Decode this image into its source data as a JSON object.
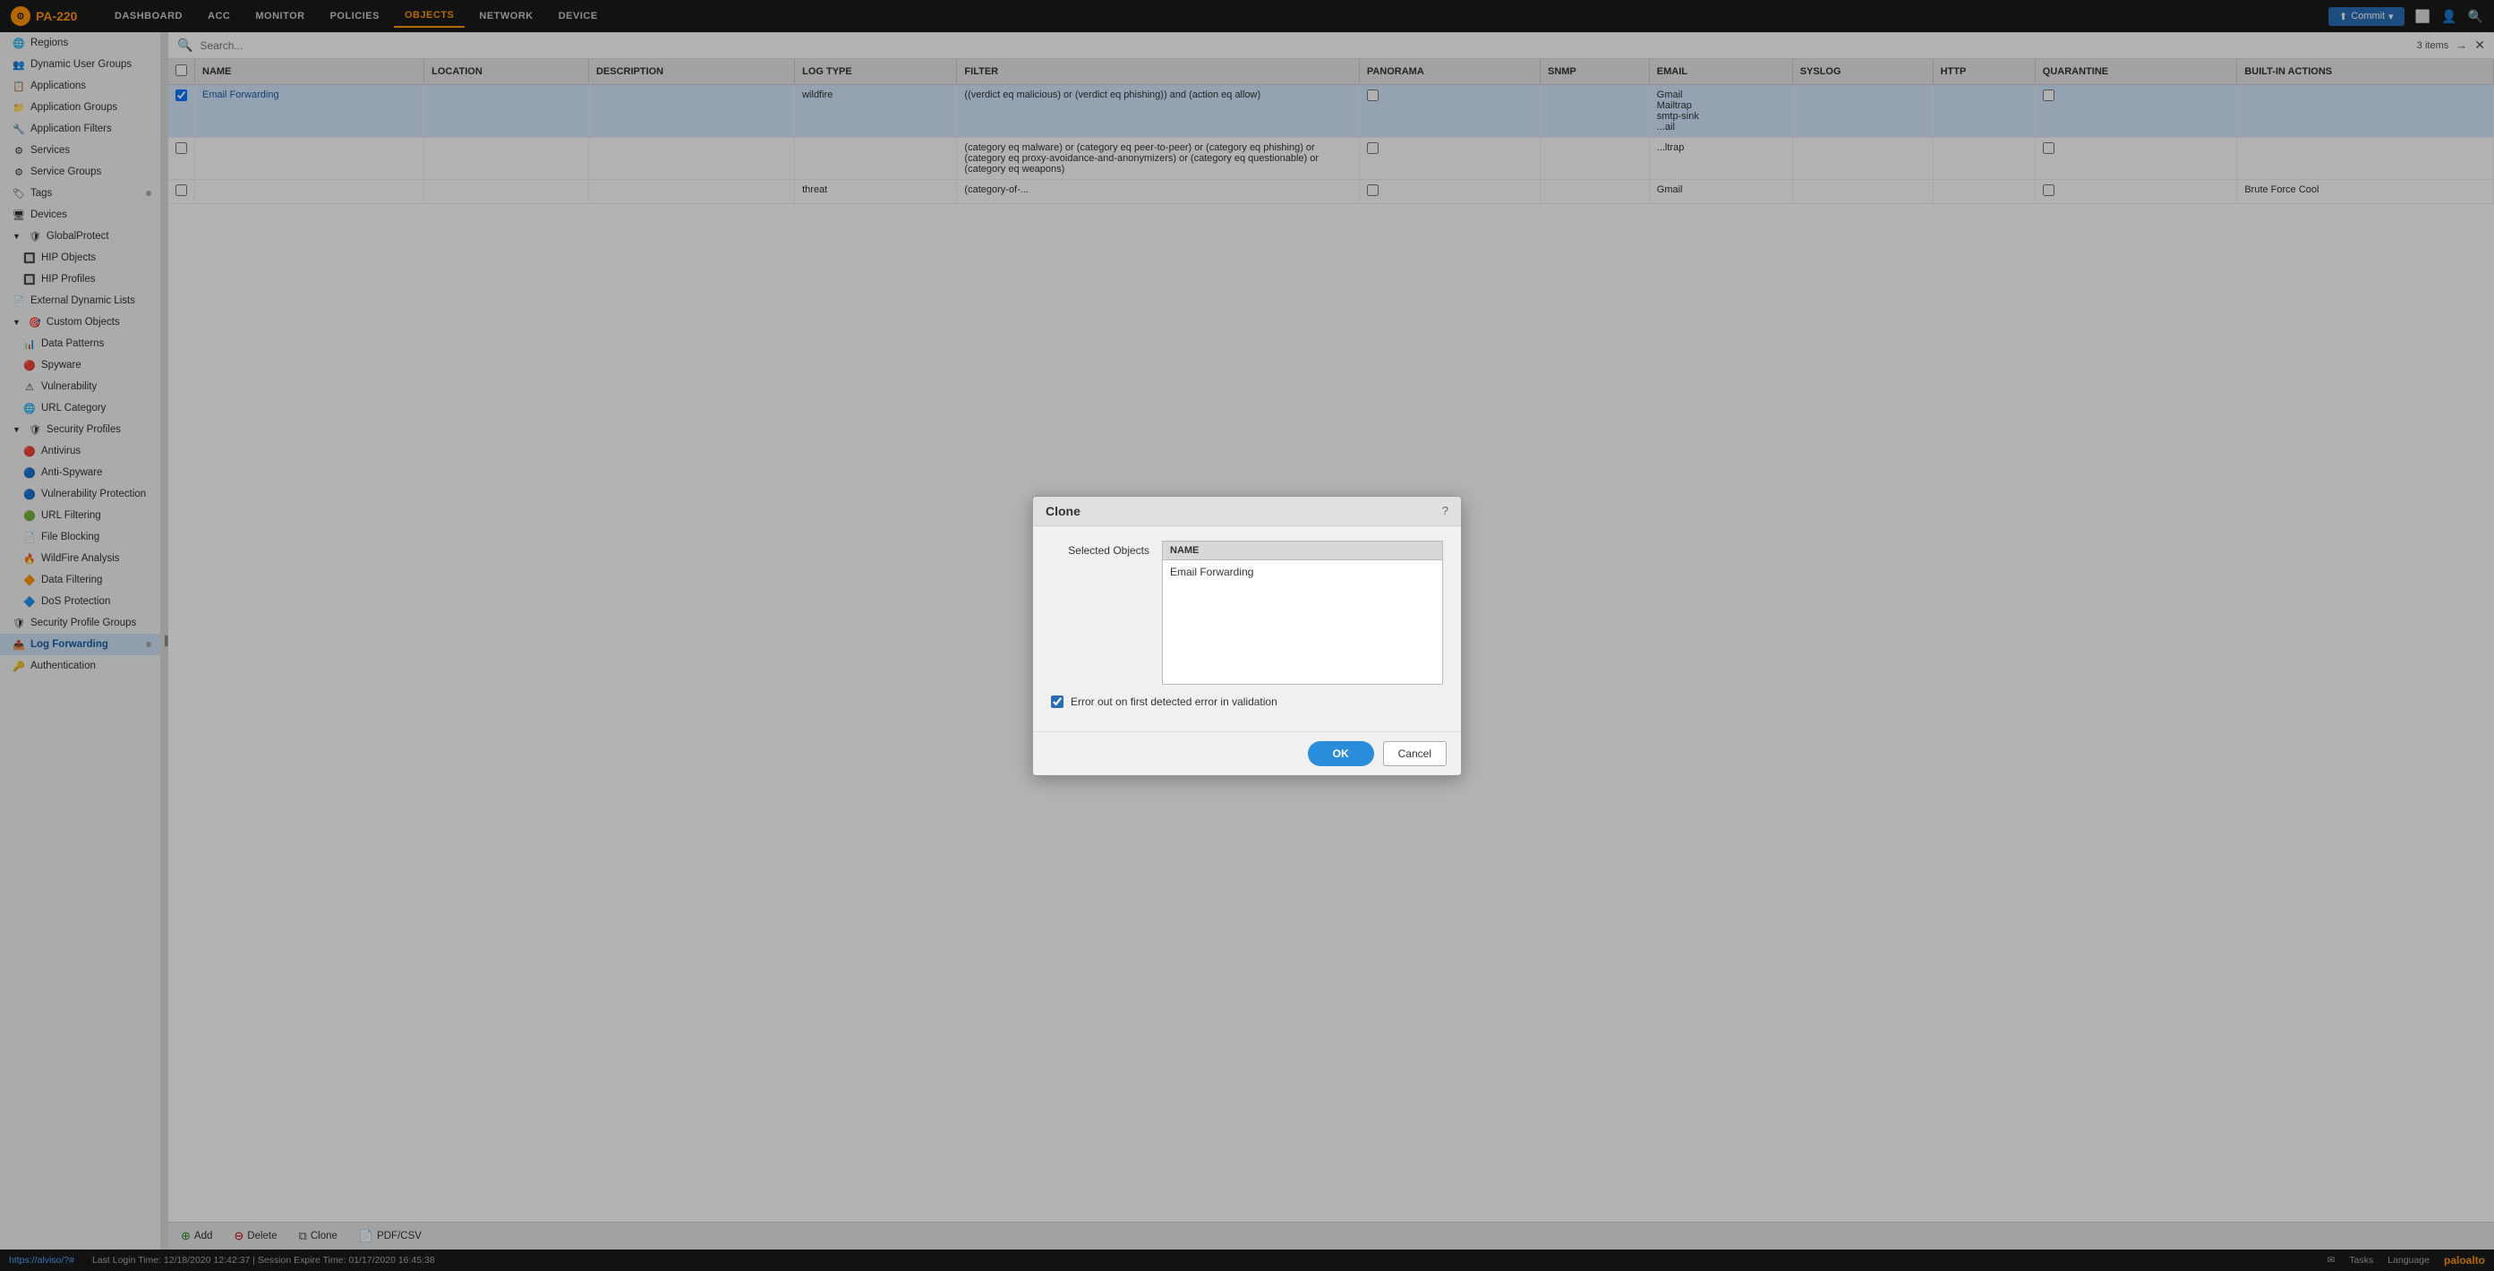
{
  "app": {
    "name": "PA-220"
  },
  "nav": {
    "items": [
      {
        "label": "DASHBOARD",
        "active": false
      },
      {
        "label": "ACC",
        "active": false
      },
      {
        "label": "MONITOR",
        "active": false
      },
      {
        "label": "POLICIES",
        "active": false
      },
      {
        "label": "OBJECTS",
        "active": true
      },
      {
        "label": "NETWORK",
        "active": false
      },
      {
        "label": "DEVICE",
        "active": false
      }
    ],
    "commit_label": "Commit",
    "items_count": "3 items"
  },
  "sidebar": {
    "items": [
      {
        "label": "Regions",
        "indent": 0,
        "icon": "globe"
      },
      {
        "label": "Dynamic User Groups",
        "indent": 0,
        "icon": "users"
      },
      {
        "label": "Applications",
        "indent": 0,
        "icon": "app"
      },
      {
        "label": "Application Groups",
        "indent": 0,
        "icon": "appgroup"
      },
      {
        "label": "Application Filters",
        "indent": 0,
        "icon": "filter"
      },
      {
        "label": "Services",
        "indent": 0,
        "icon": "service"
      },
      {
        "label": "Service Groups",
        "indent": 0,
        "icon": "servicegroup"
      },
      {
        "label": "Tags",
        "indent": 0,
        "icon": "tag",
        "badge": true
      },
      {
        "label": "Devices",
        "indent": 0,
        "icon": "device"
      },
      {
        "label": "GlobalProtect",
        "indent": 0,
        "icon": "globalprotect",
        "expanded": true
      },
      {
        "label": "HIP Objects",
        "indent": 1,
        "icon": "hip"
      },
      {
        "label": "HIP Profiles",
        "indent": 1,
        "icon": "hipprofile"
      },
      {
        "label": "External Dynamic Lists",
        "indent": 0,
        "icon": "edl"
      },
      {
        "label": "Custom Objects",
        "indent": 0,
        "icon": "custom",
        "expanded": true
      },
      {
        "label": "Data Patterns",
        "indent": 1,
        "icon": "data"
      },
      {
        "label": "Spyware",
        "indent": 1,
        "icon": "spyware"
      },
      {
        "label": "Vulnerability",
        "indent": 1,
        "icon": "vuln"
      },
      {
        "label": "URL Category",
        "indent": 1,
        "icon": "url"
      },
      {
        "label": "Security Profiles",
        "indent": 0,
        "icon": "security",
        "expanded": true
      },
      {
        "label": "Antivirus",
        "indent": 1,
        "icon": "av"
      },
      {
        "label": "Anti-Spyware",
        "indent": 1,
        "icon": "antispyware"
      },
      {
        "label": "Vulnerability Protection",
        "indent": 1,
        "icon": "vulnprot"
      },
      {
        "label": "URL Filtering",
        "indent": 1,
        "icon": "urlfilter"
      },
      {
        "label": "File Blocking",
        "indent": 1,
        "icon": "fileblock"
      },
      {
        "label": "WildFire Analysis",
        "indent": 1,
        "icon": "wildfire"
      },
      {
        "label": "Data Filtering",
        "indent": 1,
        "icon": "datafilter"
      },
      {
        "label": "DoS Protection",
        "indent": 1,
        "icon": "dos"
      },
      {
        "label": "Security Profile Groups",
        "indent": 0,
        "icon": "secgroup"
      },
      {
        "label": "Log Forwarding",
        "indent": 0,
        "icon": "logfwd",
        "active": true,
        "badge": true
      },
      {
        "label": "Authentication",
        "indent": 0,
        "icon": "auth"
      }
    ]
  },
  "table": {
    "columns": [
      {
        "label": "NAME"
      },
      {
        "label": "LOCATION"
      },
      {
        "label": "DESCRIPTION"
      },
      {
        "label": "LOG TYPE"
      },
      {
        "label": "FILTER"
      },
      {
        "label": "PANORAMA"
      },
      {
        "label": "SNMP"
      },
      {
        "label": "EMAIL"
      },
      {
        "label": "SYSLOG"
      },
      {
        "label": "HTTP"
      },
      {
        "label": "QUARANTINE"
      },
      {
        "label": "BUILT-IN ACTIONS"
      }
    ],
    "rows": [
      {
        "selected": true,
        "name": "Email Forwarding",
        "location": "",
        "description": "",
        "log_type": "wildfire",
        "filter": "((verdict eq malicious) or (verdict eq phishing)) and (action eq allow)",
        "panorama": false,
        "snmp": "",
        "email": "Gmail\nMailtrap\nsmtp-sink\n...ail",
        "email_display": [
          "Gmail",
          "Mailtrap",
          "smtp-sink",
          "...ail"
        ],
        "syslog": "",
        "http": "",
        "quarantine": false,
        "builtin_actions": ""
      },
      {
        "selected": false,
        "name": "",
        "location": "",
        "description": "",
        "log_type": "",
        "filter": "(category eq malware) or (category eq peer-to-peer) or (category eq phishing) or (category eq proxy-avoidance-and-anonymizers) or (category eq questionable) or (category eq weapons)",
        "panorama": false,
        "snmp": "",
        "email": "...ltrap",
        "email_display": [
          "...ltrap"
        ],
        "syslog": "",
        "http": "",
        "quarantine": false,
        "builtin_actions": ""
      },
      {
        "selected": false,
        "name": "",
        "location": "",
        "description": "",
        "log_type": "threat",
        "filter": "(category-of-...",
        "panorama": false,
        "snmp": "",
        "email": "Gmail",
        "email_display": [
          "Gmail"
        ],
        "syslog": "",
        "http": "",
        "quarantine": false,
        "builtin_actions": "Brute Force Cool"
      }
    ]
  },
  "toolbar": {
    "add_label": "Add",
    "delete_label": "Delete",
    "clone_label": "Clone",
    "pdfcsv_label": "PDF/CSV"
  },
  "modal": {
    "title": "Clone",
    "selected_objects_label": "Selected Objects",
    "name_column_header": "NAME",
    "items": [
      "Email Forwarding"
    ],
    "checkbox_label": "Error out on first detected error in validation",
    "checkbox_checked": true,
    "ok_label": "OK",
    "cancel_label": "Cancel"
  },
  "status_bar": {
    "url": "https://alviso/?#",
    "last_login": "Last Login Time: 12/18/2020 12:42:37  |  Session Expire Time: 01/17/2020 16:45:38",
    "tasks_label": "Tasks",
    "language_label": "Language",
    "palo_label": "paloalto"
  }
}
